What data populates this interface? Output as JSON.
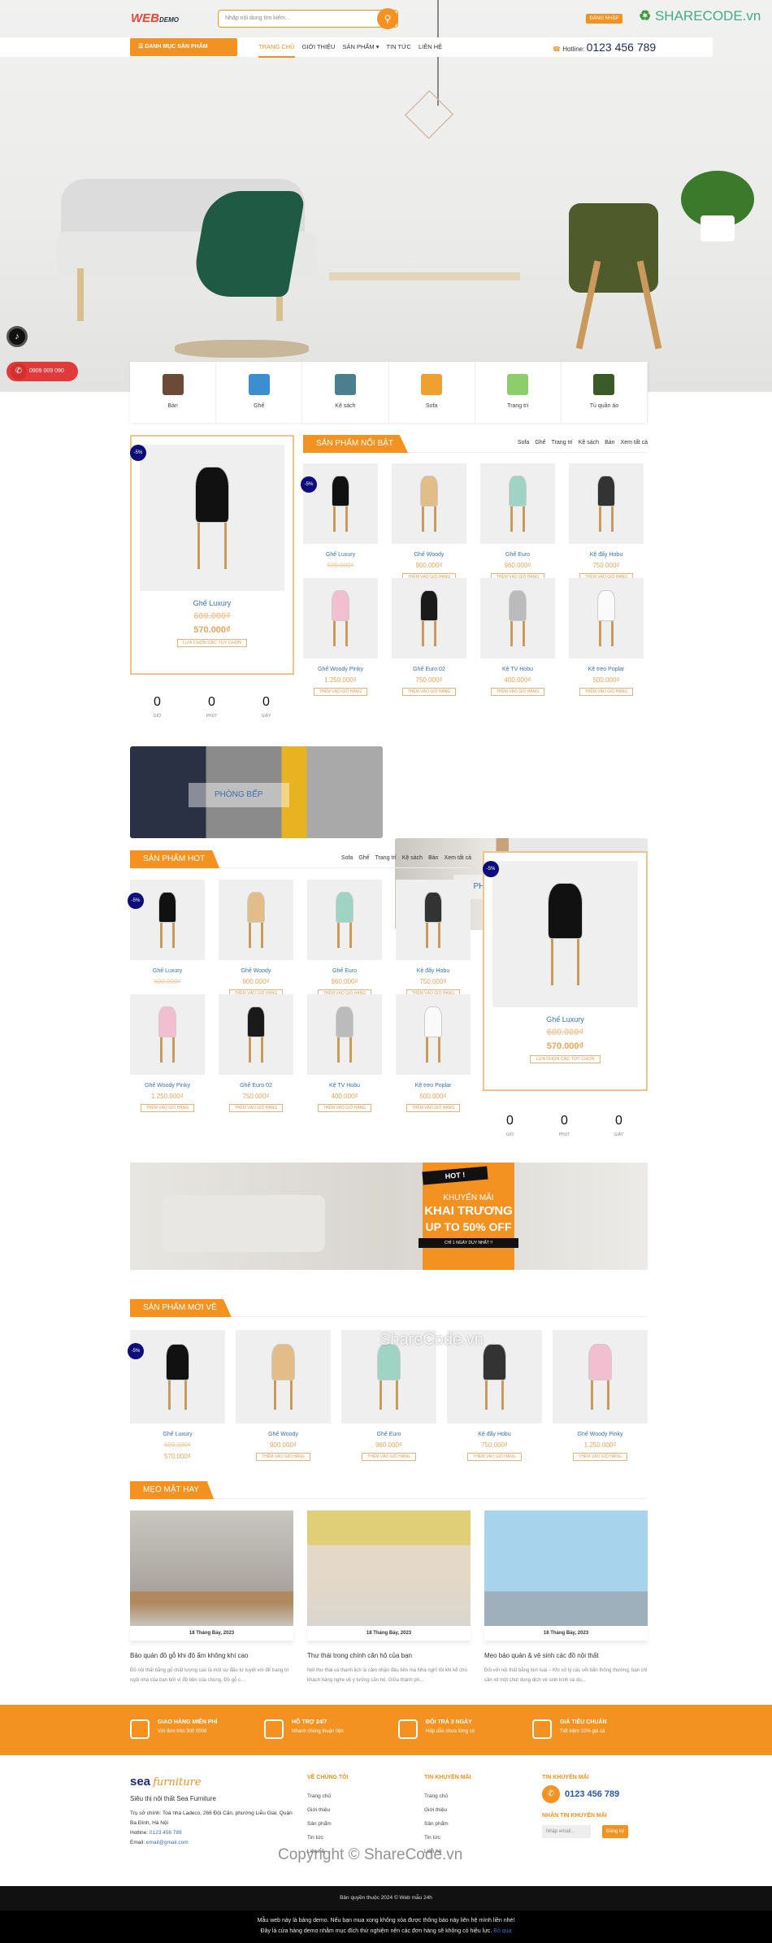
{
  "header": {
    "logo": "WEB",
    "logo_suffix": "DEMO",
    "search_placeholder": "Nhập nội dung tìm kiếm...",
    "login_label": "ĐĂNG NHẬP",
    "watermark_logo": "SHARECODE.vn",
    "category_button": "DANH MỤC SẢN PHẨM",
    "nav": [
      "TRANG CHỦ",
      "GIỚI THIỆU",
      "SẢN PHẨM ▾",
      "TIN TỨC",
      "LIÊN HỆ"
    ],
    "hotline_label": "Hotline:",
    "hotline": "0123 456 789"
  },
  "floating": {
    "phone": "0909 009 090"
  },
  "categories": [
    "Bàn",
    "Ghế",
    "Kệ sách",
    "Sofa",
    "Trang trí",
    "Tủ quần áo"
  ],
  "category_colors": [
    "#6b4a36",
    "#3b8fd1",
    "#4b7e8e",
    "#f0a030",
    "#8ccf6a",
    "#3a5a2a"
  ],
  "featured": {
    "title": "SẢN PHẨM NỔI BẬT",
    "links": [
      "Sofa",
      "Ghế",
      "Trang trí",
      "Kệ sách",
      "Bàn",
      "Xem tất cả"
    ],
    "deal": {
      "badge": "-5%",
      "name": "Ghế Luxury",
      "old_price": "600.000₫",
      "price": "570.000₫",
      "button": "LỰA CHỌN CÁC TÙY CHỌN"
    },
    "countdown": [
      {
        "value": "0",
        "unit": "GIỜ"
      },
      {
        "value": "0",
        "unit": "PHÚT"
      },
      {
        "value": "0",
        "unit": "GIÂY"
      }
    ]
  },
  "products": [
    {
      "name": "Ghế Luxury",
      "price": "600.000₫",
      "sale": true,
      "badge": "-5%",
      "color": "#111"
    },
    {
      "name": "Ghế Woody",
      "price": "900.000₫",
      "color": "#e2bd88"
    },
    {
      "name": "Ghế Euro",
      "price": "960.000₫",
      "color": "#9fd3c4"
    },
    {
      "name": "Kệ đẩy Hobu",
      "price": "750.000₫",
      "color": "#333"
    },
    {
      "name": "Ghế Woody Pinky",
      "price": "1.250.000₫",
      "color": "#f2bfd0"
    },
    {
      "name": "Ghế Euro 02",
      "price": "750.000₫",
      "color": "#1a1a1a"
    },
    {
      "name": "Kệ TV Hobu",
      "price": "400.000₫",
      "color": "#bbb"
    },
    {
      "name": "Kệ treo Poplar",
      "price": "500.000₫",
      "color": "#fafafa"
    }
  ],
  "add_to_cart": "THÊM VÀO GIỎ HÀNG",
  "banners": [
    "PHÒNG BẾP",
    "PHÒNG KHÁCH"
  ],
  "hot": {
    "title": "SẢN PHẨM HOT",
    "links": [
      "Sofa",
      "Ghế",
      "Trang trí",
      "Kệ sách",
      "Bàn",
      "Xem tất cả"
    ]
  },
  "promo": {
    "tag": "HOT !",
    "line1": "KHUYẾN MÃI",
    "line2": "KHAI TRƯƠNG",
    "line3": "UP TO 50% OFF",
    "line4": "CHỈ 1 NGÀY DUY NHẤT !!"
  },
  "new_arrivals": {
    "title": "SẢN PHẨM MỚI VỀ",
    "sale_price": "570.000₫"
  },
  "watermark": "ShareCode.vn",
  "tips": {
    "title": "MẸO MẶT HAY",
    "posts": [
      {
        "date": "18 Tháng Bảy, 2023",
        "title": "Bảo quản đồ gỗ khi độ ẩm không khí cao",
        "excerpt": "Đồ nội thất bằng gỗ chất lượng cao là một sự đầu tư tuyệt vời để trang trí ngôi nhà của bạn bởi vì độ bền của chúng. Đồ gỗ c..."
      },
      {
        "date": "18 Tháng Bảy, 2023",
        "title": "Thư thái trong chính căn hộ của bạn",
        "excerpt": "Nét thư thái và thanh lịch là cảm nhận đầu tiên mà Nhà nghĩ tôi khi kể cho khách hàng nghe về ý tưởng căn hộ. Giữa thành ph..."
      },
      {
        "date": "18 Tháng Bảy, 2023",
        "title": "Mẹo bảo quản & vệ sinh các đồ nội thất",
        "excerpt": "Đối với nội thất bằng kim loại – Khi xử lý các vết bẩn thông thường, bạn chỉ cần xịt một chút dung dịch vệ sinh kính và dù..."
      }
    ]
  },
  "features": [
    {
      "title": "GIAO HÀNG MIỄN PHÍ",
      "sub": "Với đơn trên 300 000đ"
    },
    {
      "title": "HỖ TRỢ 24/7",
      "sub": "Nhanh chóng thuận tiện"
    },
    {
      "title": "ĐỔI TRẢ 3 NGÀY",
      "sub": "Hấp dẫn chưa từng có"
    },
    {
      "title": "GIÁ TIÊU CHUẨN",
      "sub": "Tiết kiệm 10% giá cả"
    }
  ],
  "footer": {
    "brand": "sea",
    "brand_script": "furniture",
    "tagline": "Siêu thị nội thất Sea Furniture",
    "address": "Trụ sở chính: Toà nhà Ladeco, 266 Đội Cấn, phường Liễu Giai, Quận Ba Đình, Hà Nội",
    "hotline_label": "Hotline: ",
    "hotline": "0123 456 789",
    "email_label": "Email: ",
    "email": "email@gmail.com",
    "col1_title": "VỀ CHÚNG TÔI",
    "col1": [
      "Trang chủ",
      "Giới thiệu",
      "Sản phẩm",
      "Tin tức",
      "Liên hệ"
    ],
    "col2_title": "TIN KHUYẾN MÃI",
    "col2": [
      "Trang chủ",
      "Giới thiệu",
      "Sản phẩm",
      "Tin tức",
      "Liên hệ"
    ],
    "col3_title": "TIN KHUYẾN MÃI",
    "phone": "0123 456 789",
    "newsletter_title": "NHẬN TIN KHUYẾN MÃI",
    "email_placeholder": "Nhập email...",
    "subscribe": "Đăng ký",
    "watermark": "Copyright © ShareCode.vn"
  },
  "copyright": "Bản quyền thuộc 2024 © Web mẫu 24h",
  "notice": {
    "line1": "Mẫu web này là bảng demo. Nếu bạn mua xong không xóa được thông báo này liên hệ mình liền nhé!",
    "line2": "Đây là cửa hàng demo nhằm mục đích thử nghiệm nên các đơn hàng sẽ không có hiệu lực.",
    "dismiss": "Bỏ qua"
  }
}
